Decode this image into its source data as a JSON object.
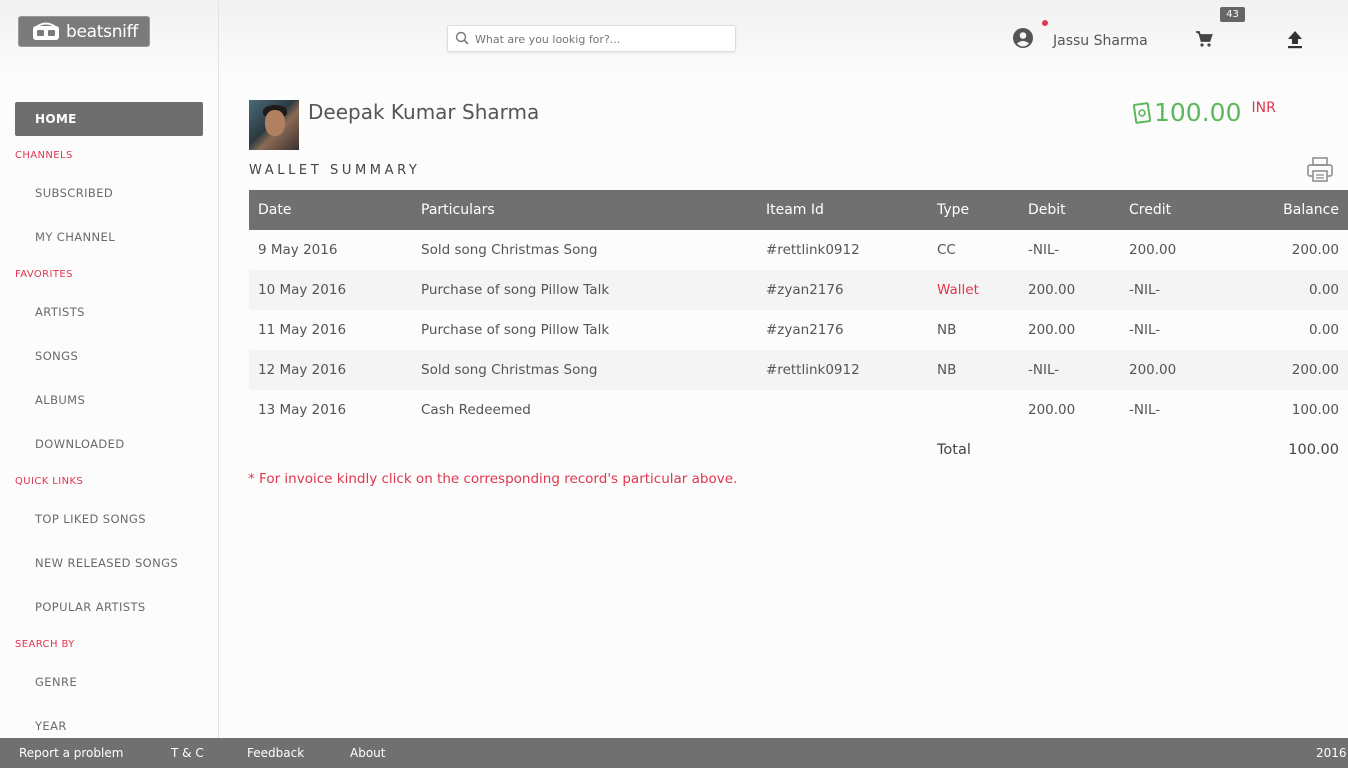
{
  "brand": {
    "name": "beatsniff"
  },
  "search": {
    "placeholder": "What are you lookig for?..."
  },
  "user": {
    "name": "Jassu Sharma"
  },
  "cart": {
    "count": "43"
  },
  "sidebar": {
    "home": "HOME",
    "sections": [
      {
        "title": "CHANNELS",
        "items": [
          "SUBSCRIBED",
          "MY CHANNEL"
        ]
      },
      {
        "title": "FAVORITES",
        "items": [
          "ARTISTS",
          "SONGS",
          "ALBUMS",
          "DOWNLOADED"
        ]
      },
      {
        "title": "QUICK LINKS",
        "items": [
          "TOP LIKED SONGS",
          "NEW RELEASED SONGS",
          "POPULAR ARTISTS"
        ]
      },
      {
        "title": "SEARCH BY",
        "items": [
          "GENRE",
          "YEAR"
        ]
      }
    ]
  },
  "profile": {
    "name": "Deepak Kumar Sharma"
  },
  "wallet": {
    "amount": "100.00",
    "currency": "INR",
    "title": "WALLET SUMMARY"
  },
  "table": {
    "headers": [
      "Date",
      "Particulars",
      "Iteam Id",
      "Type",
      "Debit",
      "Credit",
      "Balance"
    ],
    "rows": [
      [
        "9 May 2016",
        "Sold song Christmas Song",
        "#rettlink0912",
        "CC",
        "-NIL-",
        "200.00",
        "200.00"
      ],
      [
        "10 May 2016",
        "Purchase of song Pillow Talk",
        "#zyan2176",
        "Wallet",
        "200.00",
        "-NIL-",
        "0.00"
      ],
      [
        "11 May 2016",
        "Purchase of song Pillow Talk",
        "#zyan2176",
        "NB",
        "200.00",
        "-NIL-",
        "0.00"
      ],
      [
        "12 May 2016",
        "Sold song Christmas Song",
        "#rettlink0912",
        "NB",
        "-NIL-",
        "200.00",
        "200.00"
      ],
      [
        "13 May 2016",
        "Cash Redeemed",
        "",
        "",
        "200.00",
        "-NIL-",
        "100.00"
      ]
    ],
    "total_label": "Total",
    "total_value": "100.00"
  },
  "note": "* For invoice kindly click on the corresponding record's particular above.",
  "footer": {
    "links": [
      "Report a problem",
      "T & C",
      "Feedback",
      "About"
    ],
    "year": "2016"
  },
  "colors": {
    "accent": "#e0364e",
    "money": "#5cb85c",
    "header_bg": "#707070"
  }
}
